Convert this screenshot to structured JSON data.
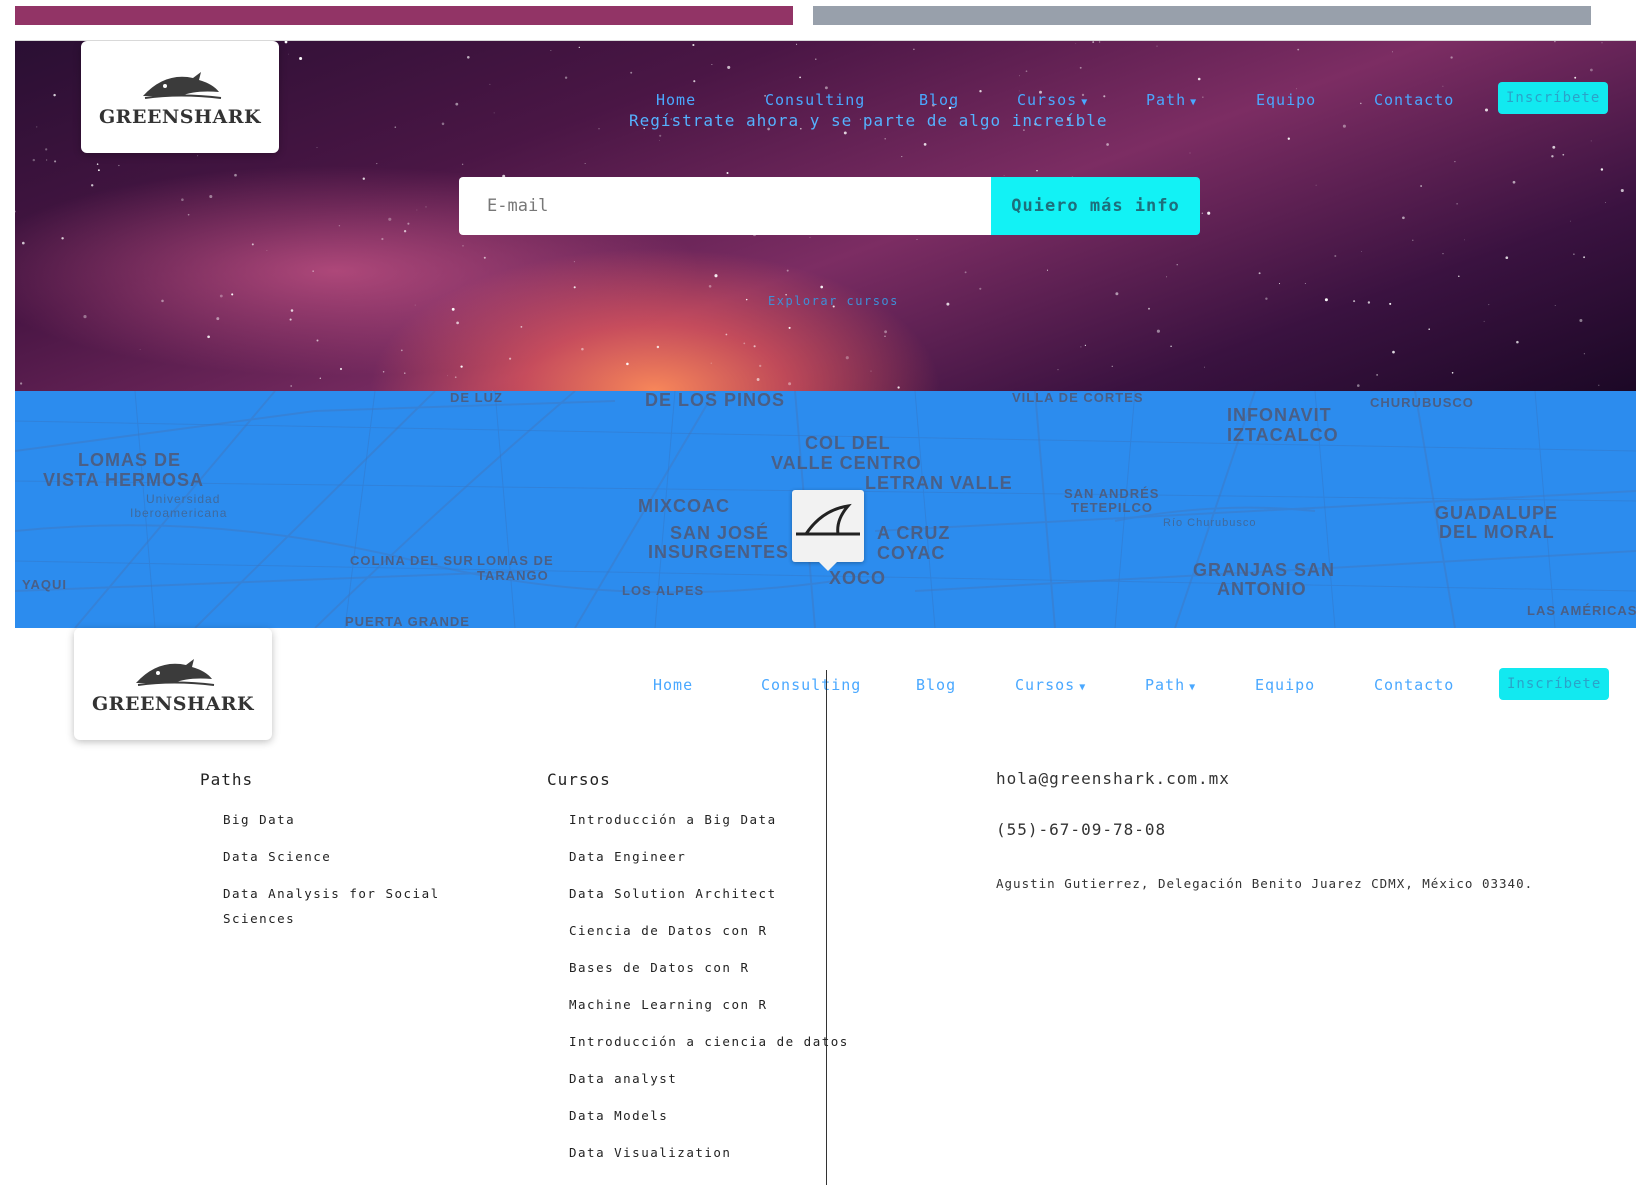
{
  "brand": {
    "name": "GREENSHARK"
  },
  "nav": {
    "items": [
      {
        "label": "Home"
      },
      {
        "label": "Consulting"
      },
      {
        "label": "Blog"
      },
      {
        "label": "Cursos",
        "dropdown": true
      },
      {
        "label": "Path",
        "dropdown": true
      },
      {
        "label": "Equipo"
      },
      {
        "label": "Contacto"
      }
    ],
    "cta_label": "Inscríbete"
  },
  "hero": {
    "tagline": "Regístrate ahora y se parte de algo increíble",
    "email_placeholder": "E-mail",
    "submit_label": "Quiero más info",
    "explore_label": "Explorar cursos"
  },
  "map": {
    "labels": [
      "DE LUZ",
      "DE LOS PINOS",
      "VILLA DE CORTES",
      "CHURUBUSCO",
      "LOMAS DE",
      "VISTA HERMOSA",
      "COL DEL",
      "VALLE CENTRO",
      "INFONAVIT",
      "IZTACALCO",
      "MIXCOAC",
      "LETRAN VALLE",
      "SAN ANDRÉS",
      "TETEPILCO",
      "GUADALUPE",
      "DEL MORAL",
      "SAN JOSÉ",
      "INSURGENTES",
      "A CRUZ",
      "COYAC",
      "XOCO",
      "COLINA DEL SUR",
      "LOMAS DE",
      "TARANGO",
      "GRANJAS SAN",
      "ANTONIO",
      "YAQUI",
      "LOS ALPES",
      "PUERTA GRANDE",
      "LAS AMÉRICAS",
      "Universidad",
      "Iberoamericana",
      "Río Churubusco"
    ]
  },
  "footer": {
    "paths": {
      "title": "Paths",
      "items": [
        "Big Data",
        "Data Science",
        "Data Analysis for Social Sciences"
      ]
    },
    "cursos": {
      "title": "Cursos",
      "items": [
        "Introducción a Big Data",
        "Data Engineer",
        "Data Solution Architect",
        "Ciencia de Datos con R",
        "Bases de Datos con R",
        "Machine Learning con R",
        "Introducción a ciencia de datos",
        "Data analyst",
        "Data Models",
        "Data Visualization"
      ]
    },
    "contact": {
      "email": "hola@greenshark.com.mx",
      "phone": "(55)-67-09-78-08",
      "address": "Agustin Gutierrez, Delegación Benito Juarez CDMX, México 03340."
    }
  },
  "colors": {
    "accent_cyan": "#12f2f5",
    "nav_link": "#4aa8ff",
    "map_blue": "#2c8cee",
    "bar_magenta": "#923466",
    "bar_gray": "#98a0ab"
  }
}
